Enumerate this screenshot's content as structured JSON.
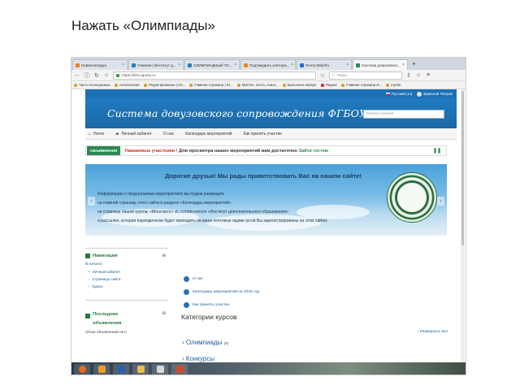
{
  "slide": {
    "title": "Нажать «Олимпиады»"
  },
  "browser": {
    "tabs": [
      {
        "label": "Новая вкладка",
        "active": false
      },
      {
        "label": "Главная | Институт д...",
        "active": false
      },
      {
        "label": "ОЛИМПИАДНЫЙ ТО...",
        "active": false
      },
      {
        "label": "Подтвердить учетную...",
        "active": false
      },
      {
        "label": "Почта Mail.Ru",
        "active": false
      },
      {
        "label": "Система довузовског...",
        "active": true
      }
    ],
    "new_tab": "+",
    "url": "https://dist.ugrasu.ru",
    "search_placeholder": "Поиск",
    "bookmarks": [
      "Часто посещаемые",
      "Антиплагиат",
      "Редактирование | Юг...",
      "Главная страница | Ю...",
      "Mail.Ru: почта, поиск...",
      "Выполнен импорт",
      "Яндекс",
      "Главная страница И...",
      "mysite"
    ]
  },
  "site": {
    "lang": "Русский (ru)",
    "user": "Ермолай Петров",
    "banner_title": "Система довузовского сопровождения ФГБОУ ВО ЮГУ",
    "search_placeholder": "Search courses",
    "menu": [
      "Home",
      "Личный кабинет",
      "О нас",
      "Календарь мероприятий",
      "Как принять участие"
    ],
    "announcement": {
      "badge": "ОБЪЯВЛЕНИЯ",
      "highlight": "Уважаемые участники !",
      "text": " Для просмотра наших мероприятий вам достаточно ",
      "link": "Зайти гостем",
      "pause": "❚❚"
    },
    "slide": {
      "heading": "Дорогие друзья! Мы рады приветствовать Вас на нашем сайте!",
      "lines": [
        "Информацию о предлагаемых мероприятиях мы будем размещать",
        "на главной странице этого сайта в разделе «Календарь мероприятий»",
        "на странице нашей группы «ВКонтакте» vk.com/dо-nerosч «Институт дополнительного образования»",
        "и рассылке, которая периодически будет приходить на ваши почтовые ящики (если Вы зарегистрированы на этом сайте)"
      ]
    },
    "navigation": {
      "title": "Навигация",
      "home": "В начало",
      "items": [
        "Личный кабинет",
        "Страницы сайта",
        "Курсы"
      ]
    },
    "news": {
      "title_line1": "Последние",
      "title_line2": "объявления",
      "empty": "(Пока объявлений нет)"
    },
    "main": {
      "links": [
        "О нас",
        "Календарь мероприятий на 2018 год",
        "Как принять участие"
      ],
      "categories_title": "Категории курсов",
      "expand_all": "Развернуть все",
      "categories": [
        {
          "name": "Олимпиады",
          "count": "(9)"
        },
        {
          "name": "Конкурсы",
          "count": ""
        }
      ]
    }
  },
  "taskbar": {
    "apps": [
      "firefox",
      "outlook",
      "word",
      "explorer",
      "media",
      "powerpoint"
    ]
  }
}
